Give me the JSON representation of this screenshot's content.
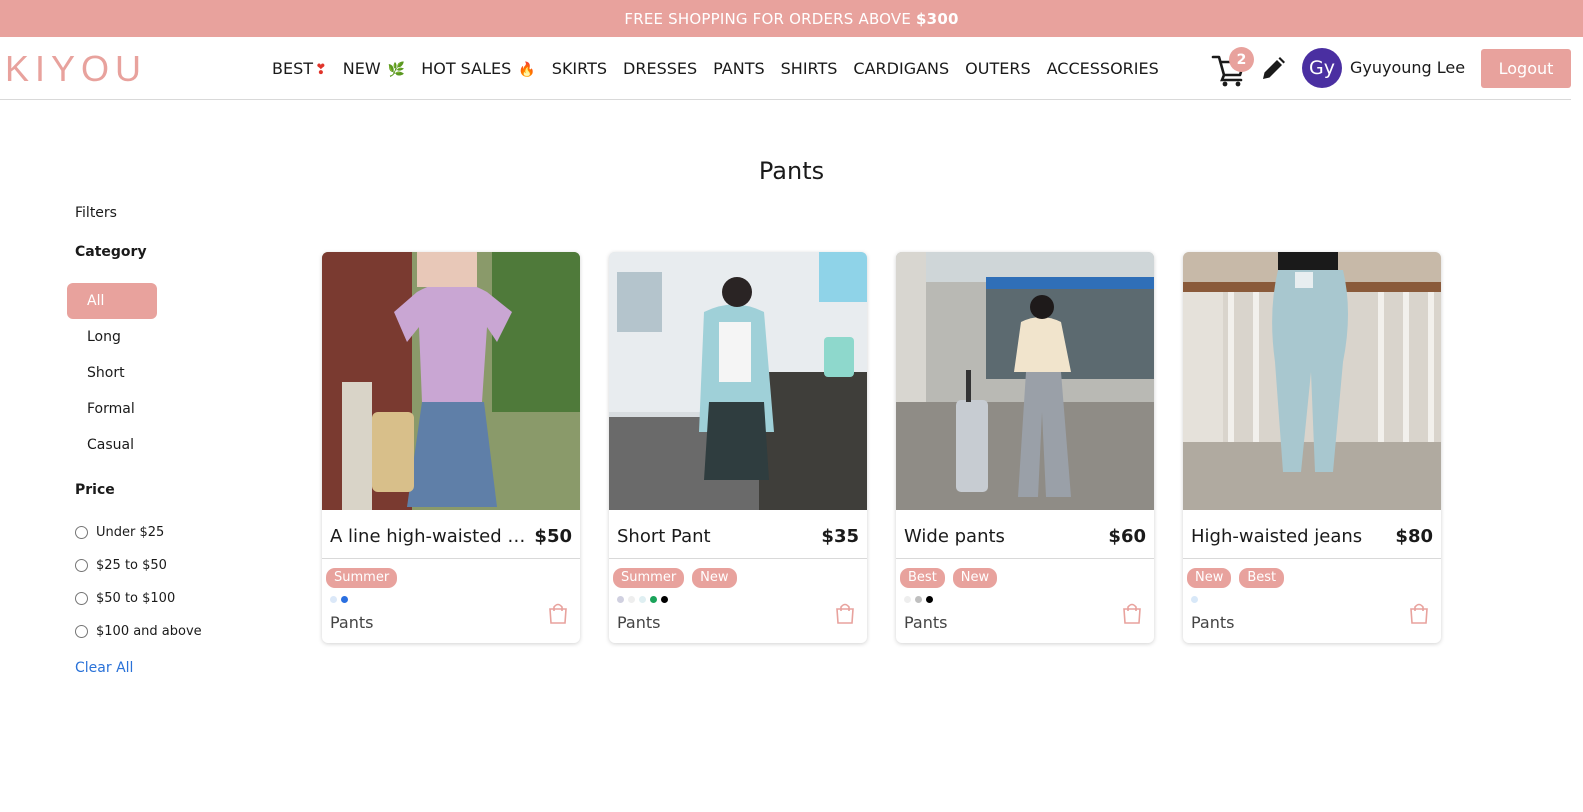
{
  "banner": {
    "text": "FREE SHOPPING FOR ORDERS ABOVE",
    "amount": "$300"
  },
  "header": {
    "logo": "KIYOU",
    "nav": [
      {
        "label": "BEST",
        "emoji": "❣"
      },
      {
        "label": "NEW",
        "emoji": "🌿"
      },
      {
        "label": "HOT SALES",
        "emoji": "🔥"
      },
      {
        "label": "SKIRTS",
        "emoji": ""
      },
      {
        "label": "DRESSES",
        "emoji": ""
      },
      {
        "label": "PANTS",
        "emoji": ""
      },
      {
        "label": "SHIRTS",
        "emoji": ""
      },
      {
        "label": "CARDIGANS",
        "emoji": ""
      },
      {
        "label": "OUTERS",
        "emoji": ""
      },
      {
        "label": "ACCESSORIES",
        "emoji": ""
      }
    ],
    "cart_count": "2",
    "avatar_initials": "Gy",
    "username": "Gyuyoung Lee",
    "logout_label": "Logout"
  },
  "page": {
    "title": "Pants"
  },
  "sidebar": {
    "filters_label": "Filters",
    "category_label": "Category",
    "categories": [
      "All",
      "Long",
      "Short",
      "Formal",
      "Casual"
    ],
    "active_category": "All",
    "price_label": "Price",
    "price_options": [
      "Under $25",
      "$25 to $50",
      "$50 to $100",
      "$100 and above"
    ],
    "clear_all_label": "Clear All"
  },
  "products": [
    {
      "name": "A line high-waisted pants",
      "display_name": "A line high-waisted p...",
      "price": "$50",
      "tags": [
        "Summer"
      ],
      "swatches": [
        "#dbe8f8",
        "#2a6fe0"
      ],
      "category": "Pants"
    },
    {
      "name": "Short Pant",
      "display_name": "Short Pant",
      "price": "$35",
      "tags": [
        "Summer",
        "New"
      ],
      "swatches": [
        "#d0d0e0",
        "#eeeeee",
        "#dfeff2",
        "#1aa35a",
        "#000000"
      ],
      "category": "Pants"
    },
    {
      "name": "Wide pants",
      "display_name": "Wide pants",
      "price": "$60",
      "tags": [
        "Best",
        "New"
      ],
      "swatches": [
        "#eeeeee",
        "#bfbfbf",
        "#000000"
      ],
      "category": "Pants"
    },
    {
      "name": "High-waisted jeans",
      "display_name": "High-waisted jeans",
      "price": "$80",
      "tags": [
        "New",
        "Best"
      ],
      "swatches": [
        "#d8e8f8"
      ],
      "category": "Pants"
    }
  ],
  "colors": {
    "accent": "#e8a29d",
    "link": "#2a72d8",
    "avatar": "#4a2fa1"
  }
}
